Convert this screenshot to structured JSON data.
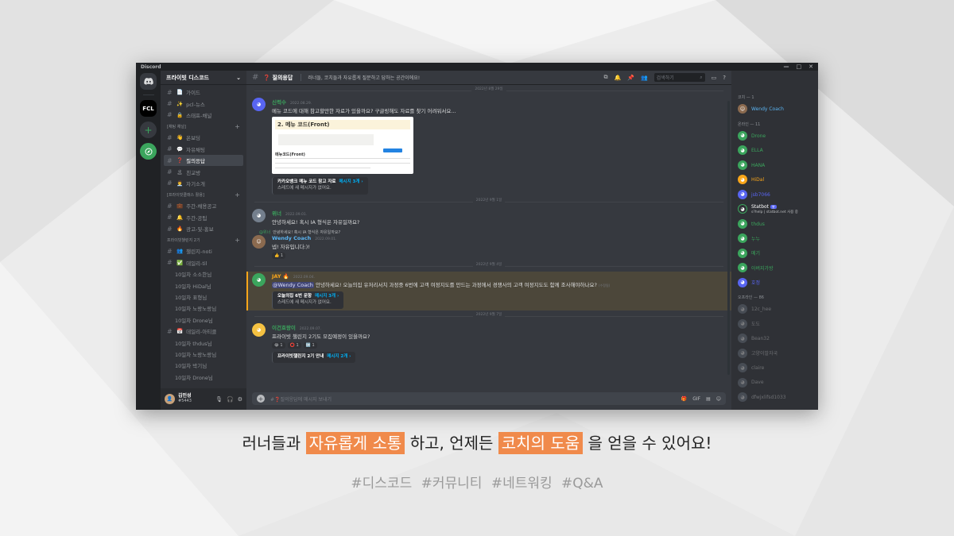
{
  "window": {
    "app_title": "Discord",
    "controls": [
      "—",
      "□",
      "✕"
    ]
  },
  "rail": {
    "fcl_label": "FCL"
  },
  "server": {
    "name": "프라이빗 디스코드"
  },
  "channels_top": [
    {
      "icon": "📄",
      "label": "가이드"
    },
    {
      "icon": "✨",
      "label": "pcl-뉴스"
    },
    {
      "icon": "🔒",
      "label": "스태프-채널"
    }
  ],
  "category_chat": "[채팅 채널]",
  "channels_chat": [
    {
      "icon": "👋",
      "label": "온보딩"
    },
    {
      "icon": "💬",
      "label": "자유채팅"
    },
    {
      "icon": "❓",
      "label": "질의응답",
      "active": true
    },
    {
      "icon": "🏝",
      "label": "친교방"
    },
    {
      "icon": "👨‍💼",
      "label": "자기소개"
    }
  ],
  "category_private": "[프라이빗클래스 활용]",
  "channels_private": [
    {
      "icon": "💼",
      "label": "주간-채용공고"
    },
    {
      "icon": "🔔",
      "label": "주간-공팁"
    },
    {
      "icon": "🔥",
      "label": "광고-및-홍보"
    }
  ],
  "category_challenge": "프라이빗챌린지 2기",
  "channels_challenge": [
    {
      "icon": "👥",
      "label": "챌린지-noti",
      "thread": true
    },
    {
      "icon": "✅",
      "label": "데일리-til",
      "thread": true
    },
    {
      "label": "10일차 소소한님",
      "sub": true
    },
    {
      "label": "10일차 HiDal님",
      "sub": true
    },
    {
      "label": "10일차 표형님",
      "sub": true
    },
    {
      "label": "10일차 노랑노랑님",
      "sub": true
    },
    {
      "label": "10일차 Drone님",
      "sub": true
    },
    {
      "icon": "📅",
      "label": "데일리-아티클",
      "thread": true
    },
    {
      "label": "10일차 thdus님",
      "sub": true
    },
    {
      "label": "10일차 노랑노랑님",
      "sub": true
    },
    {
      "label": "10일차 박기님",
      "sub": true
    },
    {
      "label": "10일차 Drone님",
      "sub": true
    }
  ],
  "user": {
    "name": "김민성",
    "tag": "#5443"
  },
  "channel": {
    "name": "❓ 질의응답",
    "topic": "러너들, 코치들과 자유롭게 질문하고 답하는 공간이에요!"
  },
  "search": {
    "placeholder": "검색하기"
  },
  "messages": {
    "date1": "2022년 8월 29일",
    "m1": {
      "author": "신력수",
      "ts": "2022.08.29.",
      "text": "메뉴 코드에 대해 참고할만한 자료가 있을까요? 구글링해도 자료를 찾기 어려워서요...",
      "embed_title": "2. 메뉴 코드(Front)",
      "embed_sub": "메뉴코드(Front)",
      "thread_name": "카카오뱅크 메뉴 코드 참고 자료",
      "thread_count": "메시지 3개 ›",
      "thread_sub": "스레드에 새 메시지가 없어요."
    },
    "date2": "2022년 9월 1일",
    "m2": {
      "author": "위너",
      "ts": "2022.09.01.",
      "text": "안녕하세요! 혹시 IA 형식은 자유일까요?"
    },
    "m3": {
      "reply_author": "@위너",
      "reply_text": "안녕하세요! 혹시 IA 형식은 자유일까요?",
      "author": "Wendy Coach",
      "ts": "2022.09.01.",
      "text": "넵! 자유입니다:)!",
      "reaction": "👍 1"
    },
    "date3": "2022년 9월 4일",
    "m4": {
      "author": "JAY 🔥",
      "ts": "2022.09.04.",
      "mention": "@Wendy Coach",
      "text": " 안녕하세요! 오늘의집 유저리서치 과정중 6번에 고객 여정지도를 만드는 과정에서 경쟁사의 고객 여정지도도 함께 조사해야하나요?",
      "edited": "(수정됨)",
      "thread_name": "오늘의집 6번 문항",
      "thread_count": "메시지 3개 ›",
      "thread_sub": "스레드에 새 메시지가 없어요."
    },
    "date4": "2022년 9월 7일",
    "m5": {
      "author": "이건호랑이",
      "ts": "2022.09.07.",
      "text": "프라이빗 챌린지 2기도 모집예정이 있을까요?",
      "reactions": [
        "😂 1",
        "⭕ 1",
        "🆗 1"
      ],
      "thread_name": "프라이빗챌린지 2기 안내",
      "thread_count": "메시지 2개 ›"
    }
  },
  "composer": {
    "placeholder": "#❓질의응답에 메시지 보내기"
  },
  "members": {
    "group1": "코치 — 1",
    "coach": "Wendy Coach",
    "group2": "온라인 — 11",
    "online": [
      {
        "name": "Drone",
        "color": "#3ba55d"
      },
      {
        "name": "ELLA",
        "color": "#3ba55d"
      },
      {
        "name": "HANA",
        "color": "#3ba55d"
      },
      {
        "name": "HiDal",
        "color": "#faa61a"
      },
      {
        "name": "jsb7066",
        "color": "#5865f2"
      },
      {
        "name": "Statbot",
        "color": "#ffffff",
        "sub": "s?help | statbot.net 사용 중",
        "bot": "봇"
      },
      {
        "name": "thdus",
        "color": "#3ba55d"
      },
      {
        "name": "누누",
        "color": "#3ba55d"
      },
      {
        "name": "메기",
        "color": "#3ba55d"
      },
      {
        "name": "아버지가방",
        "color": "#3ba55d"
      },
      {
        "name": "호정",
        "color": "#5865f2"
      }
    ],
    "group3": "오프라인 — 86",
    "offline": [
      "12c_hee",
      "도도",
      "Bean32",
      "고양이발자국",
      "claire",
      "Dave",
      "dfwjxlifsd1033"
    ]
  },
  "caption": {
    "pre": "러너들과 ",
    "hl1": "자유롭게 소통",
    "mid": " 하고, 언제든 ",
    "hl2": "코치의 도움",
    "post": " 을 얻을 수 있어요!"
  },
  "hashtags": "#디스코드  #커뮤니티  #네트워킹  #Q&A"
}
